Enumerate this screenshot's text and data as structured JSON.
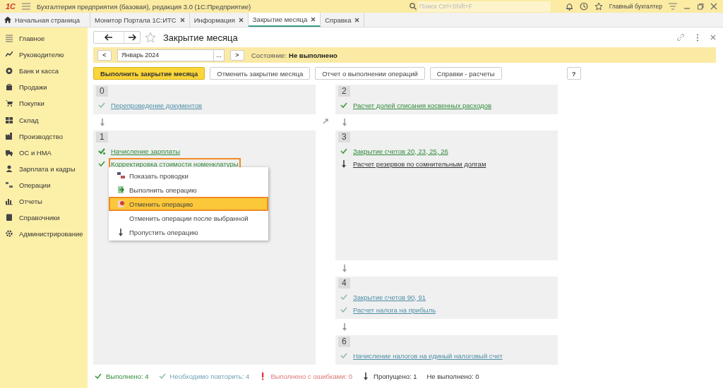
{
  "app_bar": {
    "logo": "1С",
    "title": "Бухгалтерия предприятия (базовая), редакция 3.0  (1С:Предприятие)",
    "search": {
      "placeholder": "Поиск Ctrl+Shift+F"
    },
    "user": "Главный бухгалтер"
  },
  "tabs": [
    {
      "label": "Начальная страница",
      "kind": "home",
      "selected": false
    },
    {
      "label": "Монитор Портала 1С:ИТС",
      "kind": "doc",
      "selected": false
    },
    {
      "label": "Информация",
      "kind": "doc",
      "selected": false
    },
    {
      "label": "Закрытие месяца",
      "kind": "doc",
      "selected": true
    },
    {
      "label": "Справка",
      "kind": "doc",
      "selected": false
    }
  ],
  "sidebar": {
    "items": [
      {
        "label": "Главное"
      },
      {
        "label": "Руководителю"
      },
      {
        "label": "Банк и касса"
      },
      {
        "label": "Продажи"
      },
      {
        "label": "Покупки"
      },
      {
        "label": "Склад"
      },
      {
        "label": "Производство"
      },
      {
        "label": "ОС и НМА"
      },
      {
        "label": "Зарплата и кадры"
      },
      {
        "label": "Операции"
      },
      {
        "label": "Отчеты"
      },
      {
        "label": "Справочники"
      },
      {
        "label": "Администрирование"
      }
    ]
  },
  "form": {
    "title": "Закрытие месяца",
    "period": {
      "prev": "<",
      "value": "Январь 2024",
      "choose": "...",
      "next": ">",
      "state_label": "Состояние:",
      "state_value": "Не выполнено"
    },
    "buttons": [
      {
        "label": "Выполнить закрытие месяца",
        "kind": "primary"
      },
      {
        "label": "Отменить закрытие месяца",
        "kind": "normal"
      },
      {
        "label": "Отчет о выполнении операций",
        "kind": "normal"
      },
      {
        "label": "Справки - расчеты",
        "kind": "normal"
      },
      {
        "label": "?",
        "kind": "help"
      }
    ],
    "columns": [
      [
        {
          "number": "0",
          "operations": [
            {
              "label": "Перепроведение документов",
              "kind": "repeat",
              "highlighted": false
            }
          ]
        },
        {
          "number": "1",
          "operations": [
            {
              "label": "Начисление зарплаты",
              "kind": "done_extra",
              "highlighted": false
            },
            {
              "label": "Корректировка стоимости номенклатуры",
              "kind": "done",
              "highlighted": true
            }
          ]
        }
      ],
      [
        {
          "number": "2",
          "operations": [
            {
              "label": "Расчет долей списания косвенных расходов",
              "kind": "done",
              "highlighted": false
            }
          ]
        },
        {
          "number": "3",
          "operations": [
            {
              "label": "Закрытие счетов 20, 23, 25, 26",
              "kind": "done",
              "highlighted": false
            },
            {
              "label": "Расчет резервов по сомнительным долгам",
              "kind": "skipped",
              "highlighted": false
            }
          ]
        },
        {
          "number": "4",
          "operations": [
            {
              "label": "Закрытие счетов 90, 91",
              "kind": "repeat",
              "highlighted": false
            },
            {
              "label": "Расчет налога на прибыль",
              "kind": "repeat",
              "highlighted": false
            }
          ]
        },
        {
          "number": "6",
          "operations": [
            {
              "label": "Начисление налогов на единый налоговый счет",
              "kind": "repeat",
              "highlighted": false
            }
          ]
        }
      ]
    ],
    "context_menu": {
      "items": [
        {
          "label": "Показать проводки",
          "kind": "postings",
          "selected": false
        },
        {
          "label": "Выполнить операцию",
          "kind": "run",
          "selected": false
        },
        {
          "label": "Отменить операцию",
          "kind": "cancel",
          "selected": true
        },
        {
          "label": "Отменить операции после выбранной",
          "kind": "plain",
          "selected": false
        },
        {
          "label": "Пропустить операцию",
          "kind": "skip",
          "selected": false
        }
      ]
    },
    "legend": [
      {
        "label": "Выполнено: 4",
        "kind": "done"
      },
      {
        "label": "Необходимо повторить: 4",
        "kind": "repeat"
      },
      {
        "label": "Выполнено с ошибками: 0",
        "kind": "error"
      },
      {
        "label": "Пропущено: 1",
        "kind": "skipped"
      },
      {
        "label": "Не выполнено: 0",
        "kind": "none"
      }
    ]
  }
}
